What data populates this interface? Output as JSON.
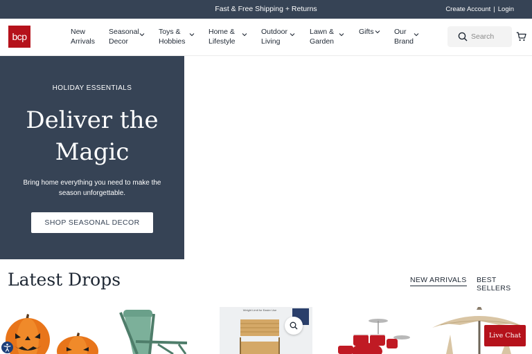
{
  "topbar": {
    "promo": "Fast & Free Shipping + Returns",
    "create_account": "Create Account",
    "separator": "|",
    "login": "Login"
  },
  "header": {
    "logo_text": "bcp",
    "nav": [
      {
        "line1": "New",
        "line2": "Arrivals",
        "has_chevron": false
      },
      {
        "line1": "Seasonal",
        "line2": "Decor",
        "has_chevron": true
      },
      {
        "line1": "Toys &",
        "line2": "Hobbies",
        "has_chevron": true
      },
      {
        "line1": "Home &",
        "line2": "Lifestyle",
        "has_chevron": true
      },
      {
        "line1": "Outdoor",
        "line2": "Living",
        "has_chevron": true
      },
      {
        "line1": "Lawn &",
        "line2": "Garden",
        "has_chevron": true
      },
      {
        "line1": "Gifts",
        "line2": "",
        "has_chevron": true
      },
      {
        "line1": "Our",
        "line2": "Brand",
        "has_chevron": true
      }
    ],
    "search_placeholder": "Search"
  },
  "hero": {
    "kicker": "HOLIDAY ESSENTIALS",
    "title": "Deliver the Magic",
    "subtitle": "Bring home everything you need to make the season unforgettable.",
    "button_label": "SHOP SEASONAL DECOR"
  },
  "latest": {
    "title": "Latest Drops",
    "tabs": [
      {
        "label": "NEW ARRIVALS",
        "active": true
      },
      {
        "label": "BEST SELLERS",
        "active": false
      }
    ],
    "products": [
      {
        "icon": "pumpkin-decor-image"
      },
      {
        "icon": "zero-gravity-chair-image"
      },
      {
        "icon": "rattan-bar-cart-image",
        "badge": "Weight Limit for Easier Use"
      },
      {
        "icon": "drum-set-image"
      },
      {
        "icon": "patio-umbrella-image"
      }
    ]
  },
  "live_chat": "Live Chat",
  "colors": {
    "navy": "#364355",
    "brand_red": "#b5121b",
    "text_dark": "#1e2733",
    "search_bg": "#f3f3f3",
    "a11y_blue": "#1d3f7a"
  }
}
